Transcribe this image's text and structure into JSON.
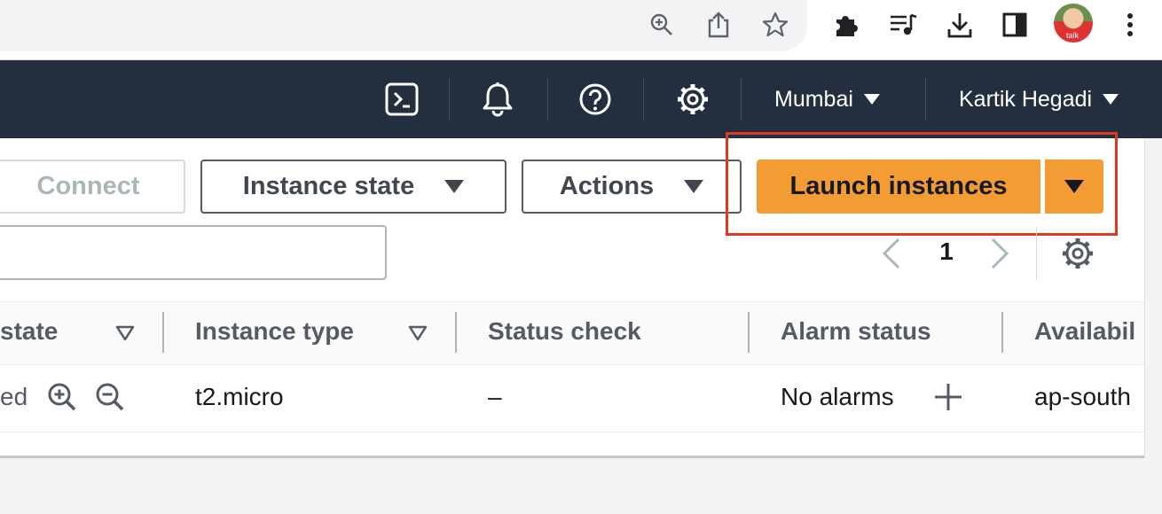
{
  "browser": {
    "toolbar_icons": [
      "zoom-icon",
      "share-icon",
      "bookmark-star-icon",
      "extensions-icon",
      "media-queue-icon",
      "download-icon",
      "sidepanel-icon",
      "profile-avatar",
      "more-menu-icon"
    ],
    "avatar_text": "talk"
  },
  "aws_nav": {
    "icons": [
      "cloudshell-icon",
      "notifications-icon",
      "help-icon",
      "settings-icon"
    ],
    "region_label": "Mumbai",
    "account_label": "Kartik Hegadi"
  },
  "toolbar": {
    "connect_label": "Connect",
    "instance_state_label": "Instance state",
    "actions_label": "Actions",
    "launch_label": "Launch instances",
    "highlight_color": "#dd3b1f",
    "launch_color": "#f39c33"
  },
  "search": {
    "value": ""
  },
  "pagination": {
    "current_page": "1"
  },
  "table": {
    "columns": [
      {
        "label": "state",
        "sortable": true
      },
      {
        "label": "Instance type",
        "sortable": true
      },
      {
        "label": "Status check",
        "sortable": false
      },
      {
        "label": "Alarm status",
        "sortable": false
      },
      {
        "label": "Availabil",
        "sortable": false
      }
    ],
    "rows": [
      {
        "state": "ed",
        "instance_type": "t2.micro",
        "status_check": "–",
        "alarm_status": "No alarms",
        "availability": "ap-south"
      }
    ]
  }
}
